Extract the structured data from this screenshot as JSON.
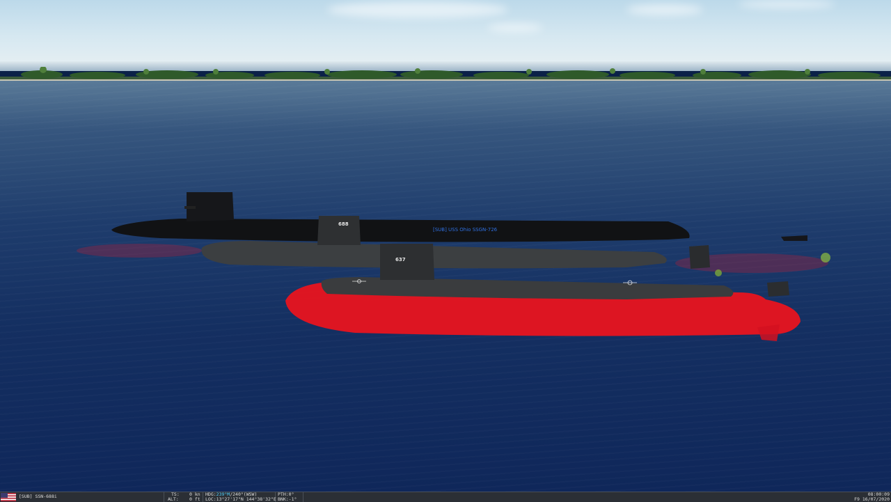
{
  "scene": {
    "labels": {
      "ohio": "[SUB] USS Ohio SSGN-726",
      "la_class": "",
      "sturgeon": ""
    },
    "hull_numbers": {
      "la_class": "688",
      "sturgeon": "637"
    }
  },
  "hud": {
    "player_unit": "[SUB] SSN-688i",
    "ts_label": "TS:",
    "ts_value": "0 kn",
    "alt_label": "ALT:",
    "alt_value": "0 ft",
    "hdg_label": "HDG:",
    "hdg_magnetic": "239°M",
    "hdg_true": "/240°(WSW)",
    "loc_label": "LOC:",
    "loc_value": "13°27'17\"N 144°38'32\"E",
    "pth_label": "PTH:",
    "pth_value": "0°",
    "bnk_label": "BNK:",
    "bnk_value": "-1°",
    "time": "08:00:09",
    "date": "F9 16/07/2020"
  },
  "colors": {
    "label_blue": "#2f6fe0",
    "heading_accent": "#4fd0ff",
    "selected_hull": "#e8141f"
  }
}
